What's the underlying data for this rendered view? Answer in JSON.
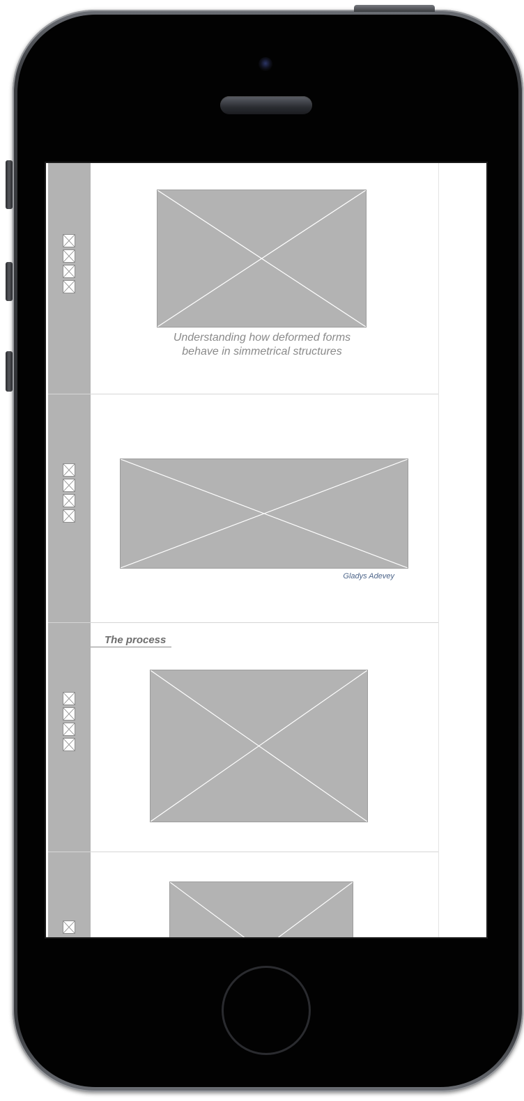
{
  "app": {
    "caption": "Understanding how deformed forms behave in simmetrical structures",
    "credit": "Gladys Adevey",
    "section_title": "The process"
  },
  "colors": {
    "placeholder_fill": "#b3b3b3",
    "rail": "#b3b3b3",
    "caption_text": "#8a8a8a",
    "credit_text": "#4c6489",
    "phone_body": "#020202"
  },
  "icons": {
    "placeholder": "image-placeholder-icon",
    "thumbnail": "thumbnail-placeholder-icon"
  }
}
